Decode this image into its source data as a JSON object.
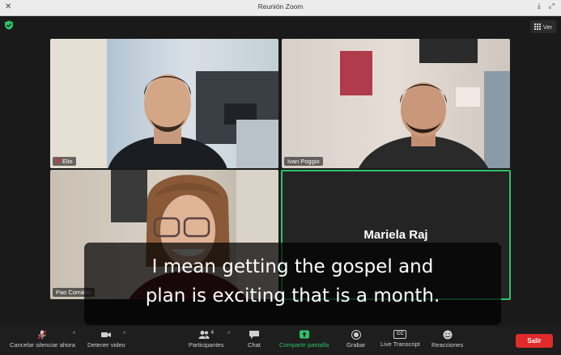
{
  "window": {
    "title": "Reunión Zoom",
    "close_glyph": "✕",
    "download_glyph": "⤓",
    "expand_glyph": "⤢"
  },
  "view_button": {
    "label": "Ver"
  },
  "participants": [
    {
      "name": "Elio",
      "muted": true
    },
    {
      "name": "Ivan Poggio",
      "muted": false
    },
    {
      "name": "Pao Corrales",
      "muted": false
    },
    {
      "name": "Mariela Raj",
      "muted": false,
      "active_speaker": true
    }
  ],
  "caption": {
    "line1": "I mean getting the gospel and",
    "line2": "plan is exciting that is a month."
  },
  "toolbar": {
    "unmute": "Cancelar silenciar ahora",
    "stop_video": "Detener video",
    "participants": "Participantes",
    "participant_count": "4",
    "chat": "Chat",
    "share_screen": "Compartir pantalla",
    "record": "Grabar",
    "transcript": "Live Transcript",
    "cc_glyph": "CC",
    "reactions": "Reacciones",
    "exit": "Salir",
    "caret_glyph": "^"
  },
  "colors": {
    "accent_green": "#2cc36b",
    "exit_red": "#e02b2b",
    "toolbar_bg": "#1e1e1e"
  }
}
